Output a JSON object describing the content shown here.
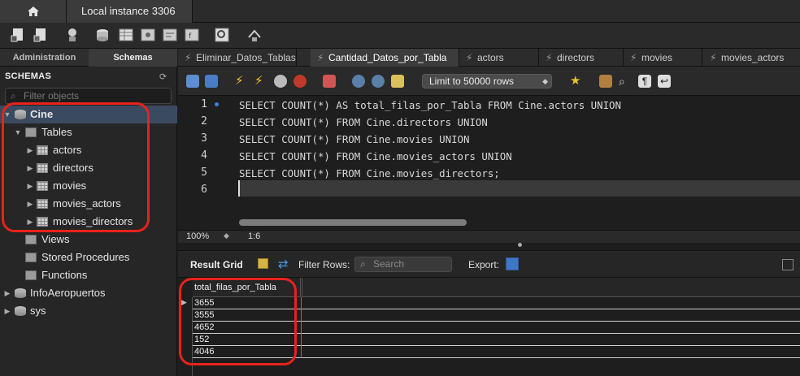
{
  "window": {
    "connection_tab": "Local instance 3306"
  },
  "sidebar": {
    "tabs": [
      "Administration",
      "Schemas"
    ],
    "active_tab": "Schemas",
    "header": "SCHEMAS",
    "filter_placeholder": "Filter objects",
    "tree": [
      {
        "label": "Cine",
        "level": 0,
        "expanded": true,
        "selected": true,
        "icon": "database-icon"
      },
      {
        "label": "Tables",
        "level": 1,
        "expanded": true,
        "icon": "folder-icon"
      },
      {
        "label": "actors",
        "level": 2,
        "icon": "table-icon"
      },
      {
        "label": "directors",
        "level": 2,
        "icon": "table-icon"
      },
      {
        "label": "movies",
        "level": 2,
        "icon": "table-icon"
      },
      {
        "label": "movies_actors",
        "level": 2,
        "icon": "table-icon"
      },
      {
        "label": "movies_directors",
        "level": 2,
        "icon": "table-icon"
      },
      {
        "label": "Views",
        "level": 1,
        "icon": "folder-icon"
      },
      {
        "label": "Stored Procedures",
        "level": 1,
        "icon": "folder-icon"
      },
      {
        "label": "Functions",
        "level": 1,
        "icon": "folder-icon"
      },
      {
        "label": "InfoAeropuertos",
        "level": 0,
        "icon": "database-icon"
      },
      {
        "label": "sys",
        "level": 0,
        "icon": "database-icon"
      }
    ]
  },
  "editor": {
    "tabs": [
      {
        "label": "Eliminar_Datos_Tablas",
        "active": false
      },
      {
        "label": "Cantidad_Datos_por_Tabla",
        "active": true
      },
      {
        "label": "actors",
        "active": false
      },
      {
        "label": "directors",
        "active": false
      },
      {
        "label": "movies",
        "active": false
      },
      {
        "label": "movies_actors",
        "active": false
      }
    ],
    "limit_select": "Limit to 50000 rows",
    "lines": [
      {
        "no": "1",
        "text": "SELECT COUNT(*) AS total_filas_por_Tabla FROM Cine.actors UNION"
      },
      {
        "no": "2",
        "text": "SELECT COUNT(*) FROM Cine.directors UNION"
      },
      {
        "no": "3",
        "text": "SELECT COUNT(*) FROM Cine.movies UNION"
      },
      {
        "no": "4",
        "text": "SELECT COUNT(*) FROM Cine.movies_actors UNION"
      },
      {
        "no": "5",
        "text": "SELECT COUNT(*) FROM Cine.movies_directors;"
      },
      {
        "no": "6",
        "text": ""
      }
    ],
    "zoom": "100%",
    "cursor_position": "1:6"
  },
  "result": {
    "label": "Result Grid",
    "filter_rows_label": "Filter Rows:",
    "search_placeholder": "Search",
    "export_label": "Export:",
    "column": "total_filas_por_Tabla",
    "rows": [
      "3655",
      "3555",
      "4652",
      "152",
      "4046"
    ]
  },
  "colors": {
    "highlight": "#e8221c",
    "selection": "#3a4a60",
    "background": "#1e1e1e"
  }
}
